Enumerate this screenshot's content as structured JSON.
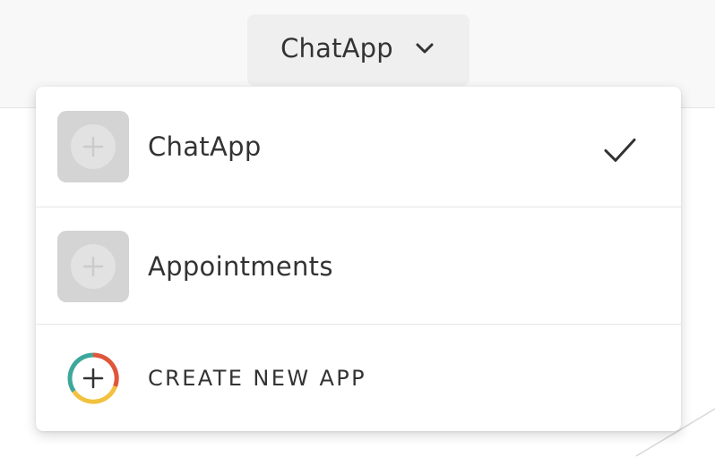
{
  "header": {
    "app_switcher_label": "ChatApp",
    "chevron_icon": "chevron-down-icon"
  },
  "dropdown": {
    "apps": [
      {
        "name": "ChatApp",
        "icon": "app-placeholder-plus-icon",
        "selected": true
      },
      {
        "name": "Appointments",
        "icon": "app-placeholder-plus-icon",
        "selected": false
      }
    ],
    "selected_icon": "checkmark-icon",
    "create_label": "CREATE NEW APP",
    "create_icon": "multicolor-plus-circle-icon"
  },
  "colors": {
    "text": "#333333",
    "ring_teal": "#3ea79b",
    "ring_red": "#e0563a",
    "ring_yellow": "#f2c13e",
    "placeholder_bg": "#d4d4d4",
    "switcher_bg": "#efefef"
  }
}
